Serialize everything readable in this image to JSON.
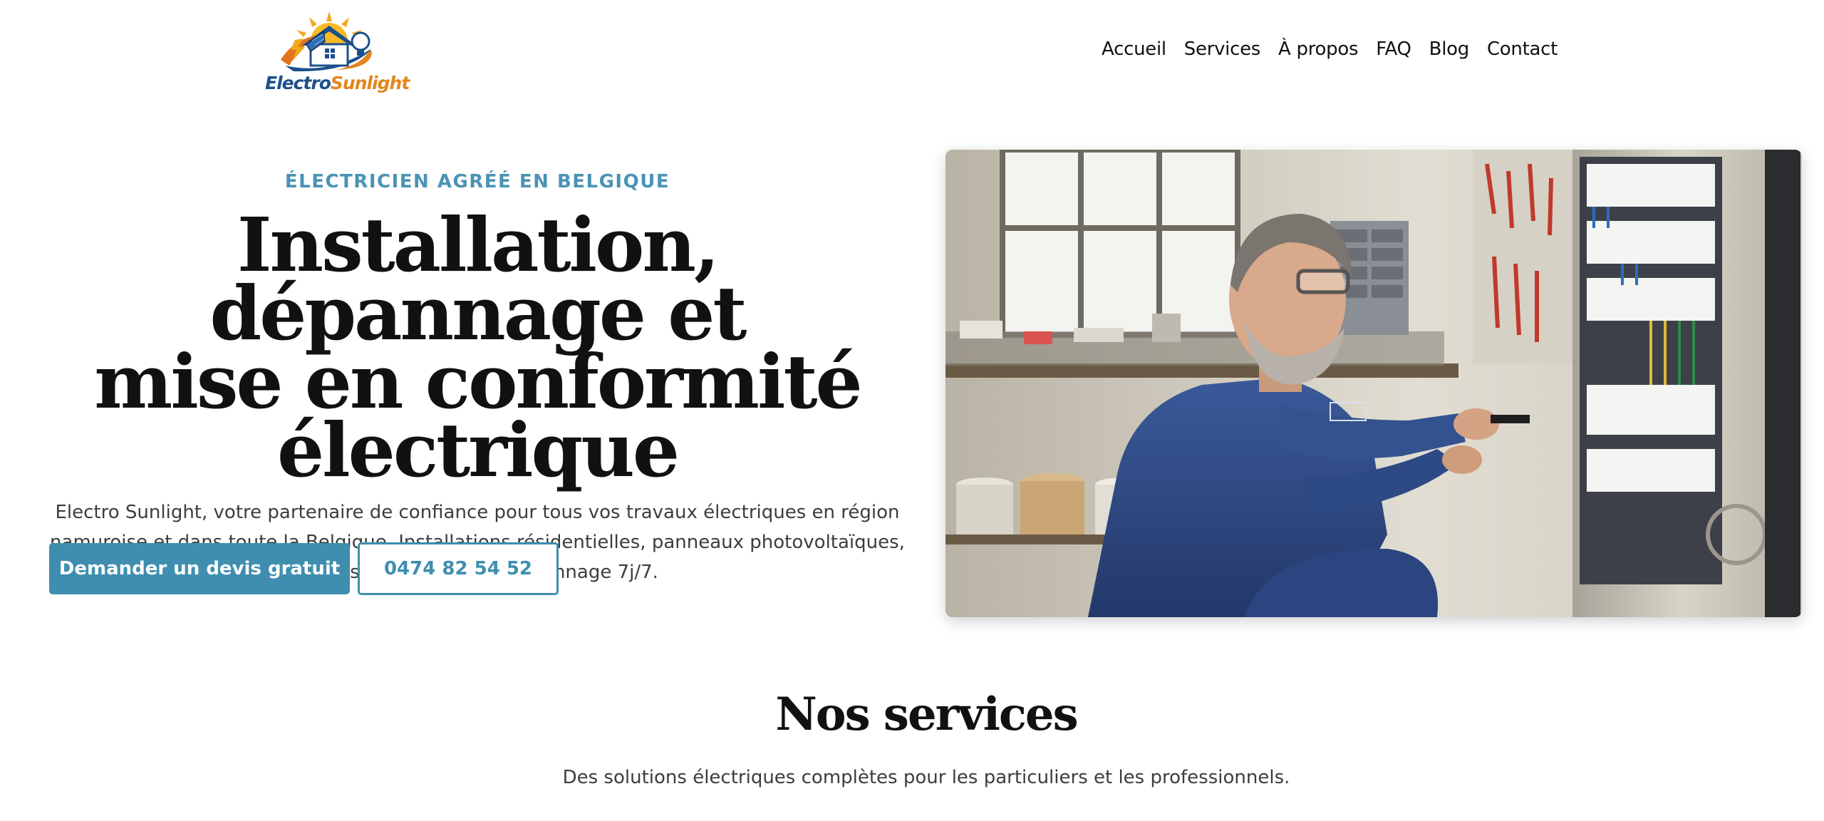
{
  "brand": {
    "name_part1": "Electro",
    "name_part2": "Sunlight"
  },
  "nav": {
    "items": [
      "Accueil",
      "Services",
      "À propos",
      "FAQ",
      "Blog",
      "Contact"
    ]
  },
  "hero": {
    "eyebrow": "ÉLECTRICIEN AGRÉÉ EN BELGIQUE",
    "title_line1": "Installation, dépannage et",
    "title_line2": "mise en conformité",
    "title_line3": "électrique",
    "description": "Electro Sunlight, votre partenaire de confiance pour tous vos travaux électriques en région namuroise et dans toute la Belgique. Installations résidentielles, panneaux photovoltaïques, bornes de recharge et dépannage 7j/7.",
    "primary_cta": "Demander un devis gratuit",
    "phone_cta": "0474 82 54 52"
  },
  "services": {
    "title": "Nos services",
    "subtitle": "Des solutions électriques complètes pour les particuliers et les professionnels."
  },
  "colors": {
    "accent": "#3f8eaf",
    "eyebrow": "#4a93b5",
    "logo_blue": "#1d4f8c",
    "logo_orange": "#e2861c"
  }
}
